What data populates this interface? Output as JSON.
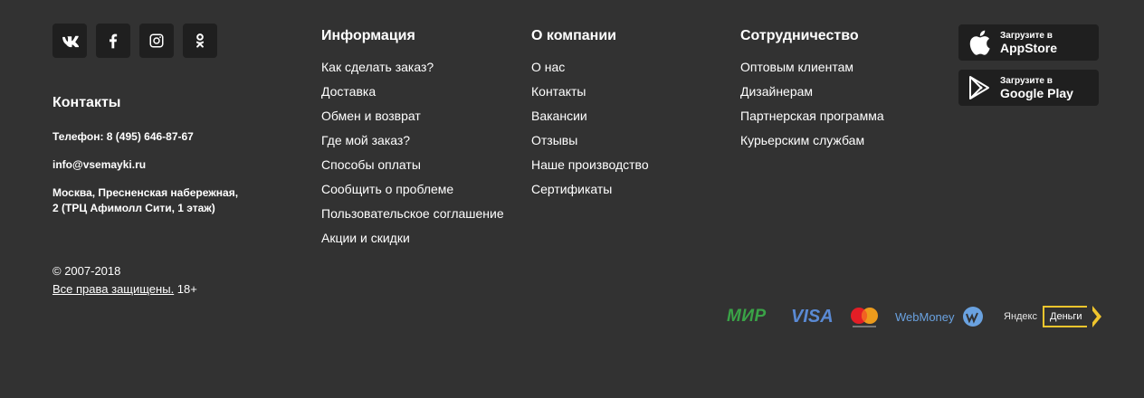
{
  "social": [
    {
      "name": "vk-icon"
    },
    {
      "name": "facebook-icon"
    },
    {
      "name": "instagram-icon"
    },
    {
      "name": "odnoklassniki-icon"
    }
  ],
  "contacts": {
    "title": "Контакты",
    "phone": "Телефон: 8 (495) 646-87-67",
    "email": "info@vsemayki.ru",
    "address_line1": "Москва, Пресненская набережная,",
    "address_line2": "2 (ТРЦ Афимолл Сити, 1 этаж)"
  },
  "copyright": {
    "years": "© 2007-2018",
    "rights_link": "Все права защищены.",
    "age": " 18+"
  },
  "columns": [
    {
      "title": "Информация",
      "items": [
        "Как сделать заказ?",
        "Доставка",
        "Обмен и возврат",
        "Где мой заказ?",
        "Способы оплаты",
        "Сообщить о проблеме",
        "Пользовательское соглашение",
        "Акции и скидки"
      ]
    },
    {
      "title": "О компании",
      "items": [
        "О нас",
        "Контакты",
        "Вакансии",
        "Отзывы",
        "Наше производство",
        "Сертификаты"
      ]
    },
    {
      "title": "Сотрудничество",
      "items": [
        "Оптовым клиентам",
        "Дизайнерам",
        "Партнерская программа",
        "Курьерским службам"
      ]
    }
  ],
  "stores": {
    "appstore": {
      "small": "Загрузите в",
      "big": "AppStore"
    },
    "googleplay": {
      "small": "Загрузите в",
      "big": "Google Play"
    }
  },
  "payments": {
    "mir": "МИР",
    "visa": "VISA",
    "webmoney": "WebMoney",
    "yandex": "Яндекс",
    "dengi": "Деньги"
  },
  "colors": {
    "background": "#323232",
    "button_bg": "#1f1f1f",
    "mir": "#3aa347",
    "visa": "#5a8ad4",
    "webmoney": "#6aa2e0",
    "yandex_border": "#f0c52d"
  }
}
